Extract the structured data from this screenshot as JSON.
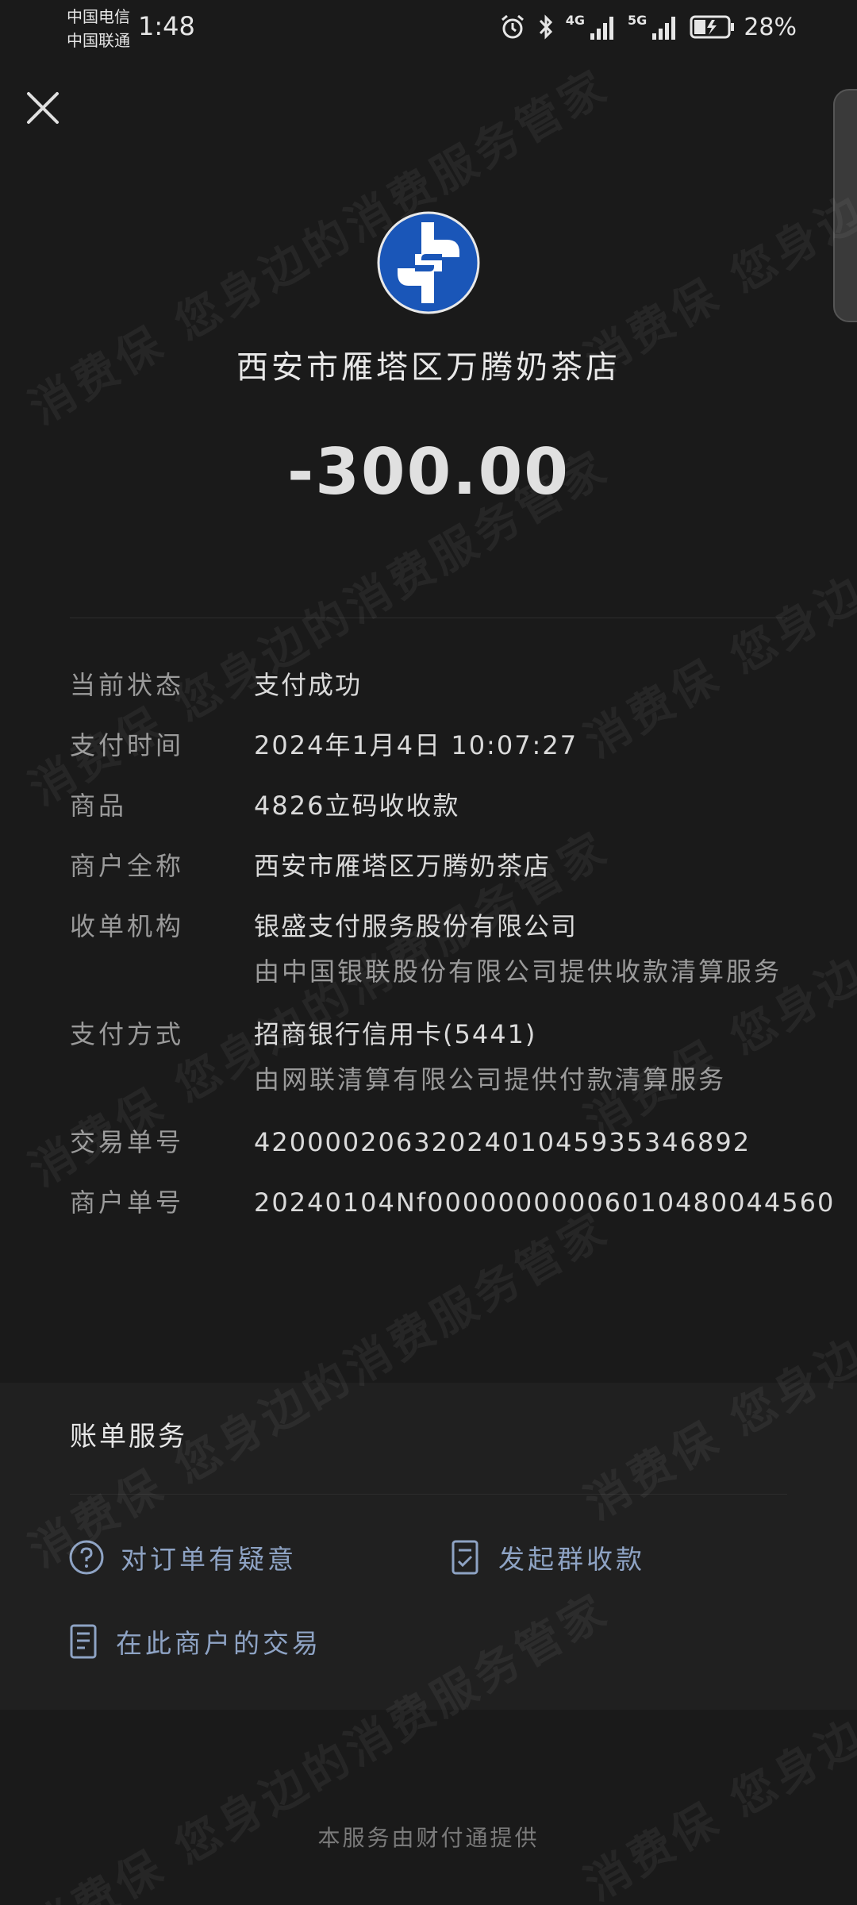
{
  "status_bar": {
    "carrier_1": "中国电信",
    "carrier_2": "中国联通",
    "time": "1:48",
    "net_1": "4G",
    "net_2": "5G",
    "battery": "28%"
  },
  "merchant": {
    "name": "西安市雁塔区万腾奶茶店",
    "amount": "-300.00"
  },
  "details": {
    "status_label": "当前状态",
    "status_value": "支付成功",
    "time_label": "支付时间",
    "time_value": "2024年1月4日 10:07:27",
    "goods_label": "商品",
    "goods_value": "4826立码收收款",
    "fullname_label": "商户全称",
    "fullname_value": "西安市雁塔区万腾奶茶店",
    "acquirer_label": "收单机构",
    "acquirer_value": "银盛支付服务股份有限公司",
    "acquirer_note": "由中国银联股份有限公司提供收款清算服务",
    "method_label": "支付方式",
    "method_value": "招商银行信用卡(5441)",
    "method_note": "由网联清算有限公司提供付款清算服务",
    "txn_label": "交易单号",
    "txn_value": "4200002063202401045935346892",
    "merchant_no_label": "商户单号",
    "merchant_no_value": "20240104Nf00000000006010480044560"
  },
  "services": {
    "title": "账单服务",
    "item_question": "对订单有疑意",
    "item_group": "发起群收款",
    "item_history": "在此商户的交易"
  },
  "footer": "本服务由财付通提供",
  "watermark_text": "消费保 您身边的消费服务管家",
  "colors": {
    "background": "#1a1a1a",
    "service_panel": "#202020",
    "link": "#8ea3c4",
    "logo_blue": "#1a56b8"
  },
  "icons": [
    "close-icon",
    "alarm-icon",
    "bluetooth-icon",
    "signal-icon",
    "battery-icon",
    "question-icon",
    "checklist-icon",
    "document-icon",
    "merchant-logo"
  ]
}
